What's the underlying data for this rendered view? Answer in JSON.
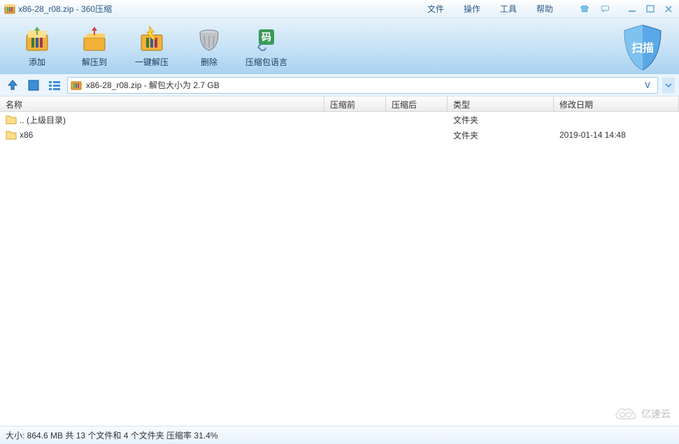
{
  "titlebar": {
    "title": "x86-28_r08.zip - 360压缩"
  },
  "menubar": {
    "file": "文件",
    "operation": "操作",
    "tools": "工具",
    "help": "帮助"
  },
  "toolbar": {
    "add": "添加",
    "extract_to": "解压到",
    "one_click_extract": "一键解压",
    "delete": "删除",
    "zip_language": "压缩包语言",
    "scan": "扫描"
  },
  "pathbar": {
    "text": "x86-28_r08.zip - 解包大小为 2.7 GB",
    "v_label": "V"
  },
  "columns": {
    "name": "名称",
    "before": "压缩前",
    "after": "压缩后",
    "type": "类型",
    "date": "修改日期"
  },
  "rows": [
    {
      "name": ".. (上级目录)",
      "before": "",
      "after": "",
      "type": "文件夹",
      "date": ""
    },
    {
      "name": "x86",
      "before": "",
      "after": "",
      "type": "文件夹",
      "date": "2019-01-14 14:48"
    }
  ],
  "statusbar": {
    "text": "大小: 864.6 MB 共 13 个文件和 4 个文件夹 压缩率 31.4%"
  },
  "watermark": {
    "text": "亿速云"
  }
}
